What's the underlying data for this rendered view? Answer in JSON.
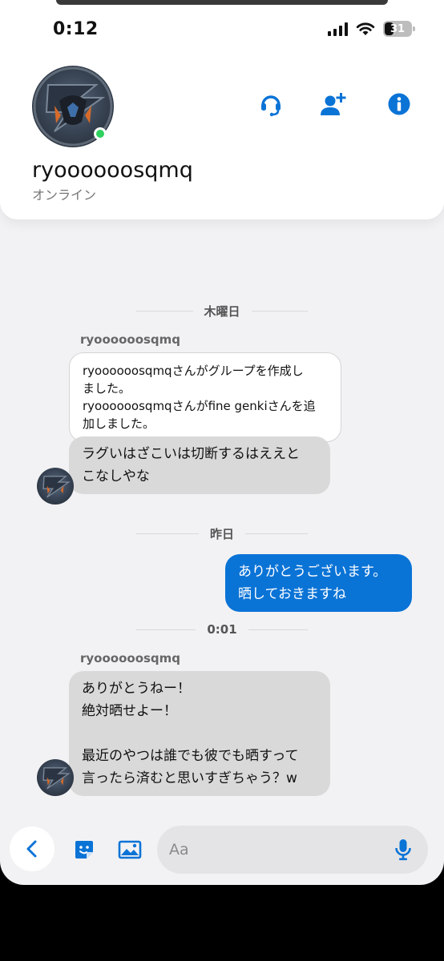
{
  "status_bar": {
    "time": "0:12",
    "battery": "31"
  },
  "header": {
    "contact_name": "ryoooooosqmq",
    "presence": "オンライン",
    "icons": [
      "avatar",
      "headset-icon",
      "add-user-icon",
      "info-icon"
    ]
  },
  "chat": {
    "separators": [
      "木曜日",
      "昨日",
      "0:01"
    ],
    "sender_name": "ryoooooosqmq",
    "system_message": {
      "lines": [
        "ryoooooosqmqさんがグループを作成し",
        "ました。",
        "ryoooooosqmqさんがfine genkiさんを追",
        "加しました。"
      ]
    },
    "messages": [
      {
        "direction": "in",
        "lines": [
          "ラグいはざこいは切断するはええと",
          "こなしやな"
        ]
      },
      {
        "direction": "out",
        "lines": [
          "ありがとうございます。",
          "晒しておきますね"
        ]
      },
      {
        "direction": "in",
        "lines": [
          "ありがとうねー！",
          "絶対晒せよー！",
          "",
          "最近のやつは誰でも彼でも晒すって",
          "言ったら済むと思いすぎちゃう？w"
        ]
      }
    ]
  },
  "composer": {
    "placeholder": "Aa",
    "icons": [
      "back-chevron-icon",
      "sticker-icon",
      "image-icon",
      "mic-icon"
    ]
  },
  "colors": {
    "accent": "#0a73d6",
    "online": "#2fd15f",
    "incoming_bubble": "#d9d9d9",
    "background": "#f2f2f4"
  }
}
